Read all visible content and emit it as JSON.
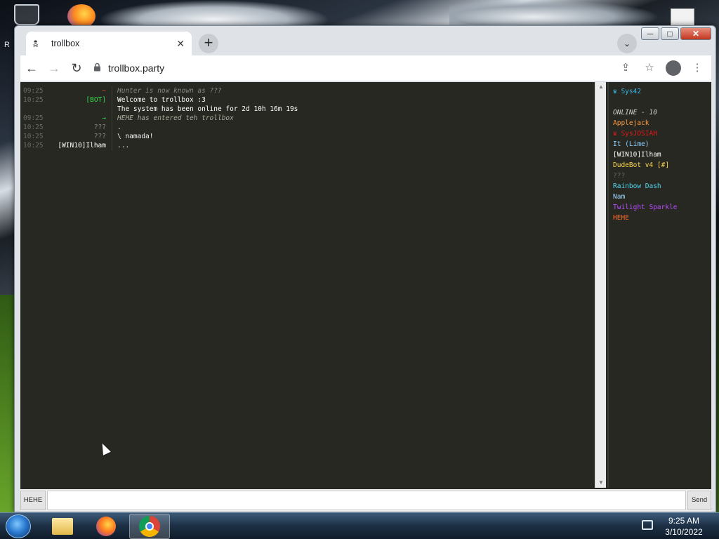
{
  "desktop": {
    "partial_label": "R"
  },
  "window": {
    "controls": {
      "minimize": "─",
      "maximize": "□",
      "close": "✕"
    }
  },
  "tab": {
    "favicon": "🕱",
    "title": "trollbox",
    "close": "✕"
  },
  "new_tab_label": "+",
  "tab_dropdown_label": "⌄",
  "toolbar": {
    "back": "←",
    "forward": "→",
    "reload": "↻",
    "url": "trollbox.party",
    "share_icon": "⇪",
    "star_icon": "☆",
    "menu_icon": "⋮"
  },
  "chat": {
    "messages": [
      {
        "time": "09:25",
        "nick": "~",
        "nick_color": "#e64a19",
        "text": "Hunter is now known as ???",
        "text_color": "#8a8a80",
        "italic": true
      },
      {
        "time": "10:25",
        "nick": "[BOT]",
        "nick_color": "#37d84a",
        "text": "Welcome to trollbox :3",
        "text_color": "#ffffff",
        "italic": false
      },
      {
        "time": "",
        "nick": "",
        "nick_color": "#ffffff",
        "text": "The system has been online for 2d 10h 16m 19s",
        "text_color": "#ffffff",
        "italic": false
      },
      {
        "time": "09:25",
        "nick": "→",
        "nick_color": "#37d84a",
        "text": "HEHE has entered teh trollbox",
        "text_color": "#a9a99a",
        "italic": true
      },
      {
        "time": "10:25",
        "nick": "???",
        "nick_color": "#8a8a80",
        "text": ".",
        "text_color": "#f0f0f0",
        "italic": false
      },
      {
        "time": "10:25",
        "nick": "???",
        "nick_color": "#8a8a80",
        "text": "\\ namada!",
        "text_color": "#f0f0f0",
        "italic": false
      },
      {
        "time": "10:25",
        "nick": "[WIN10]Ilham",
        "nick_color": "#ffffff",
        "text": "...",
        "text_color": "#f0f0f0",
        "italic": false
      }
    ]
  },
  "scrollbar": {
    "up": "▲",
    "down": "▼"
  },
  "userlist": {
    "top_user": "♛ Sys42",
    "top_user_color": "#3ab7e8",
    "online_header": "ONLINE - 10",
    "users": [
      {
        "name": "Applejack",
        "color": "#ff9b3d"
      },
      {
        "name": "♛ SysJOSIAH",
        "color": "#e01b1b"
      },
      {
        "name": "It (Lime)",
        "color": "#8fd1ff"
      },
      {
        "name": "[WIN10]Ilham",
        "color": "#ffffff"
      },
      {
        "name": "DudeBot v4 [#]",
        "color": "#ffd84a"
      },
      {
        "name": "???",
        "color": "#6a6a60"
      },
      {
        "name": "Rainbow Dash",
        "color": "#50d7f0"
      },
      {
        "name": "Nam",
        "color": "#9fd6ff"
      },
      {
        "name": "Twilight Sparkle",
        "color": "#b84cff"
      },
      {
        "name": "HEHE",
        "color": "#ff6a2a"
      }
    ]
  },
  "inputbar": {
    "nick_label": "HEHE",
    "send_label": "Send"
  },
  "taskbar": {
    "time": "9:25 AM",
    "date": "3/10/2022"
  }
}
